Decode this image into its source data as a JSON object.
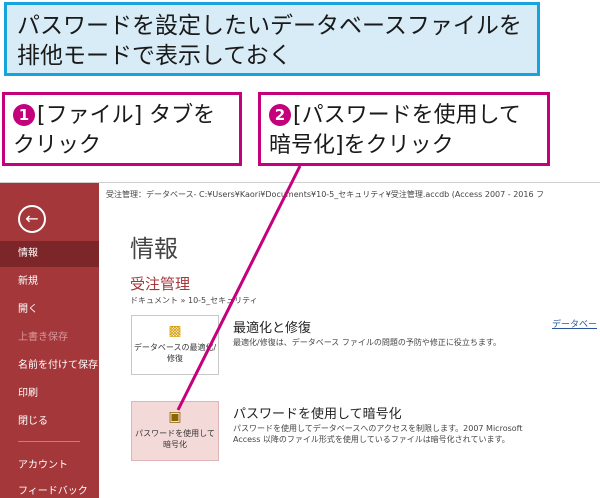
{
  "callouts": {
    "top": "パスワードを設定したいデータベースファイルを排他モードで表示しておく",
    "step1_num": "1",
    "step1": "[ファイル] タブをクリック",
    "step2_num": "2",
    "step2": "[パスワードを使用して暗号化]をクリック"
  },
  "window": {
    "filepath": "受注管理：データベース- C:¥Users¥Kaori¥Documents¥10-5_セキュリティ¥受注管理.accdb (Access 2007 - 2016 フ"
  },
  "sidebar": {
    "back_icon": "back-arrow-icon",
    "items": [
      {
        "label": "情報"
      },
      {
        "label": "新規"
      },
      {
        "label": "開く"
      },
      {
        "label": "上書き保存"
      },
      {
        "label": "名前を付けて保存"
      },
      {
        "label": "印刷"
      },
      {
        "label": "閉じる"
      },
      {
        "label": "アカウント"
      },
      {
        "label": "フィードバック"
      }
    ]
  },
  "main": {
    "title": "情報",
    "db_name": "受注管理",
    "breadcrumb": "ドキュメント » 10-5_セキュリティ",
    "compact": {
      "tile_label": "データベースの最適化/修復",
      "title": "最適化と修復",
      "desc": "最適化/修復は、データベース ファイルの問題の予防や修正に役立ちます。"
    },
    "encrypt": {
      "tile_label": "パスワードを使用して暗号化",
      "title": "パスワードを使用して暗号化",
      "desc": "パスワードを使用してデータベースへのアクセスを制限します。2007 Microsoft Access 以降のファイル形式を使用しているファイルは暗号化されています。"
    },
    "right_link": "データベー"
  },
  "colors": {
    "accent": "#a4373a",
    "callout_border": "#c4007a",
    "top_border": "#17a3dc"
  }
}
